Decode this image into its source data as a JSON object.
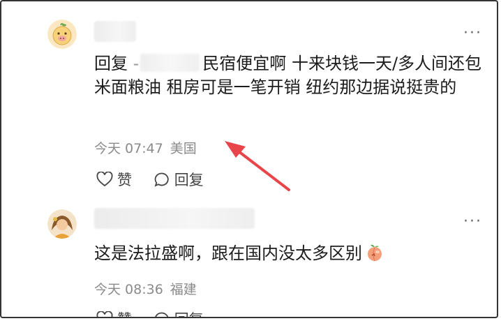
{
  "comments": [
    {
      "reply_prefix": "回复",
      "reply_dash": "-",
      "text": "民宿便宜啊 十来块钱一天/多人间还包米面粮油 租房可是一笔开销 纽约那边据说挺贵的",
      "time": "今天 07:47",
      "location": "美国",
      "like_label": "赞",
      "reply_label": "回复"
    },
    {
      "text": "这是法拉盛啊，跟在国内没太多区别",
      "time": "今天 08:36",
      "location": "福建",
      "like_label": "赞",
      "reply_label": "回复"
    }
  ],
  "more_glyph": "···",
  "colors": {
    "arrow": "#e8454a",
    "meta_text": "#8a8a8a",
    "icon_stroke": "#444444"
  },
  "icons": [
    "pig-avatar-icon",
    "more-dots-icon",
    "heart-icon",
    "comment-bubble-icon",
    "peach-emoji-icon",
    "red-arrow-annotation"
  ]
}
